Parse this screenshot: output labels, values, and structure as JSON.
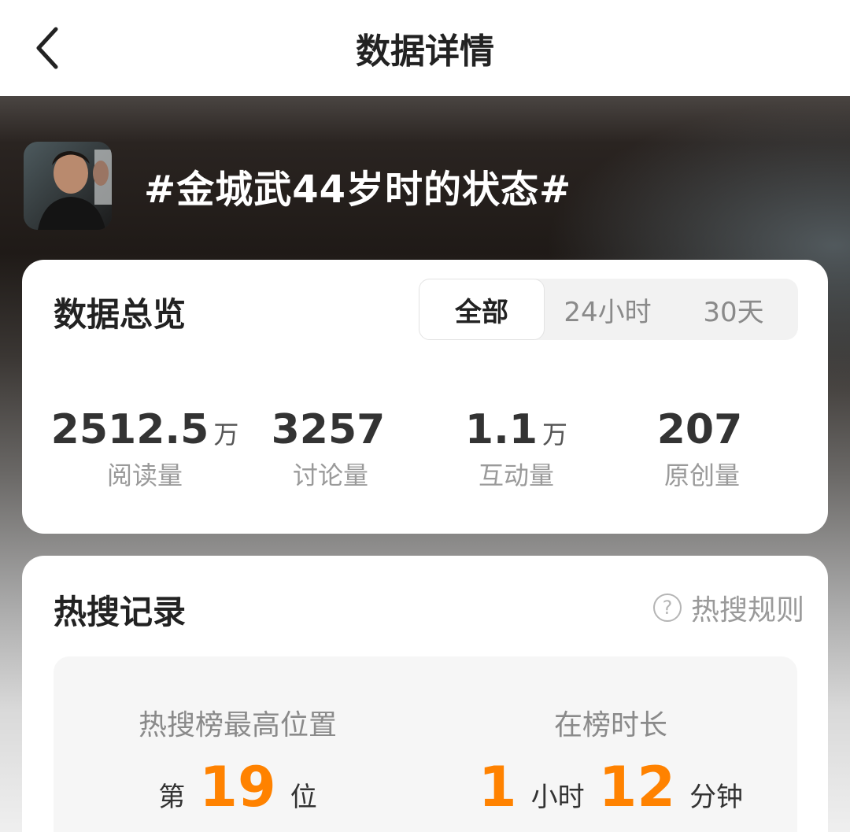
{
  "header": {
    "title": "数据详情"
  },
  "topic": {
    "title": "#金城武44岁时的状态#"
  },
  "overview": {
    "title": "数据总览",
    "tabs": [
      {
        "label": "全部",
        "active": true
      },
      {
        "label": "24小时",
        "active": false
      },
      {
        "label": "30天",
        "active": false
      }
    ],
    "stats": [
      {
        "value": "2512.5",
        "unit": "万",
        "label": "阅读量"
      },
      {
        "value": "3257",
        "unit": "",
        "label": "讨论量"
      },
      {
        "value": "1.1",
        "unit": "万",
        "label": "互动量"
      },
      {
        "value": "207",
        "unit": "",
        "label": "原创量"
      }
    ]
  },
  "hot_search": {
    "title": "热搜记录",
    "rules_label": "热搜规则",
    "rules_icon": "question-circle-icon",
    "best_position": {
      "label": "热搜榜最高位置",
      "prefix": "第",
      "value": "19",
      "suffix": "位"
    },
    "duration": {
      "label": "在榜时长",
      "hours": "1",
      "hours_unit": "小时",
      "minutes": "12",
      "minutes_unit": "分钟"
    }
  },
  "colors": {
    "accent_orange": "#ff8200",
    "title_text": "#222222",
    "muted_text": "#9a9a9a"
  }
}
